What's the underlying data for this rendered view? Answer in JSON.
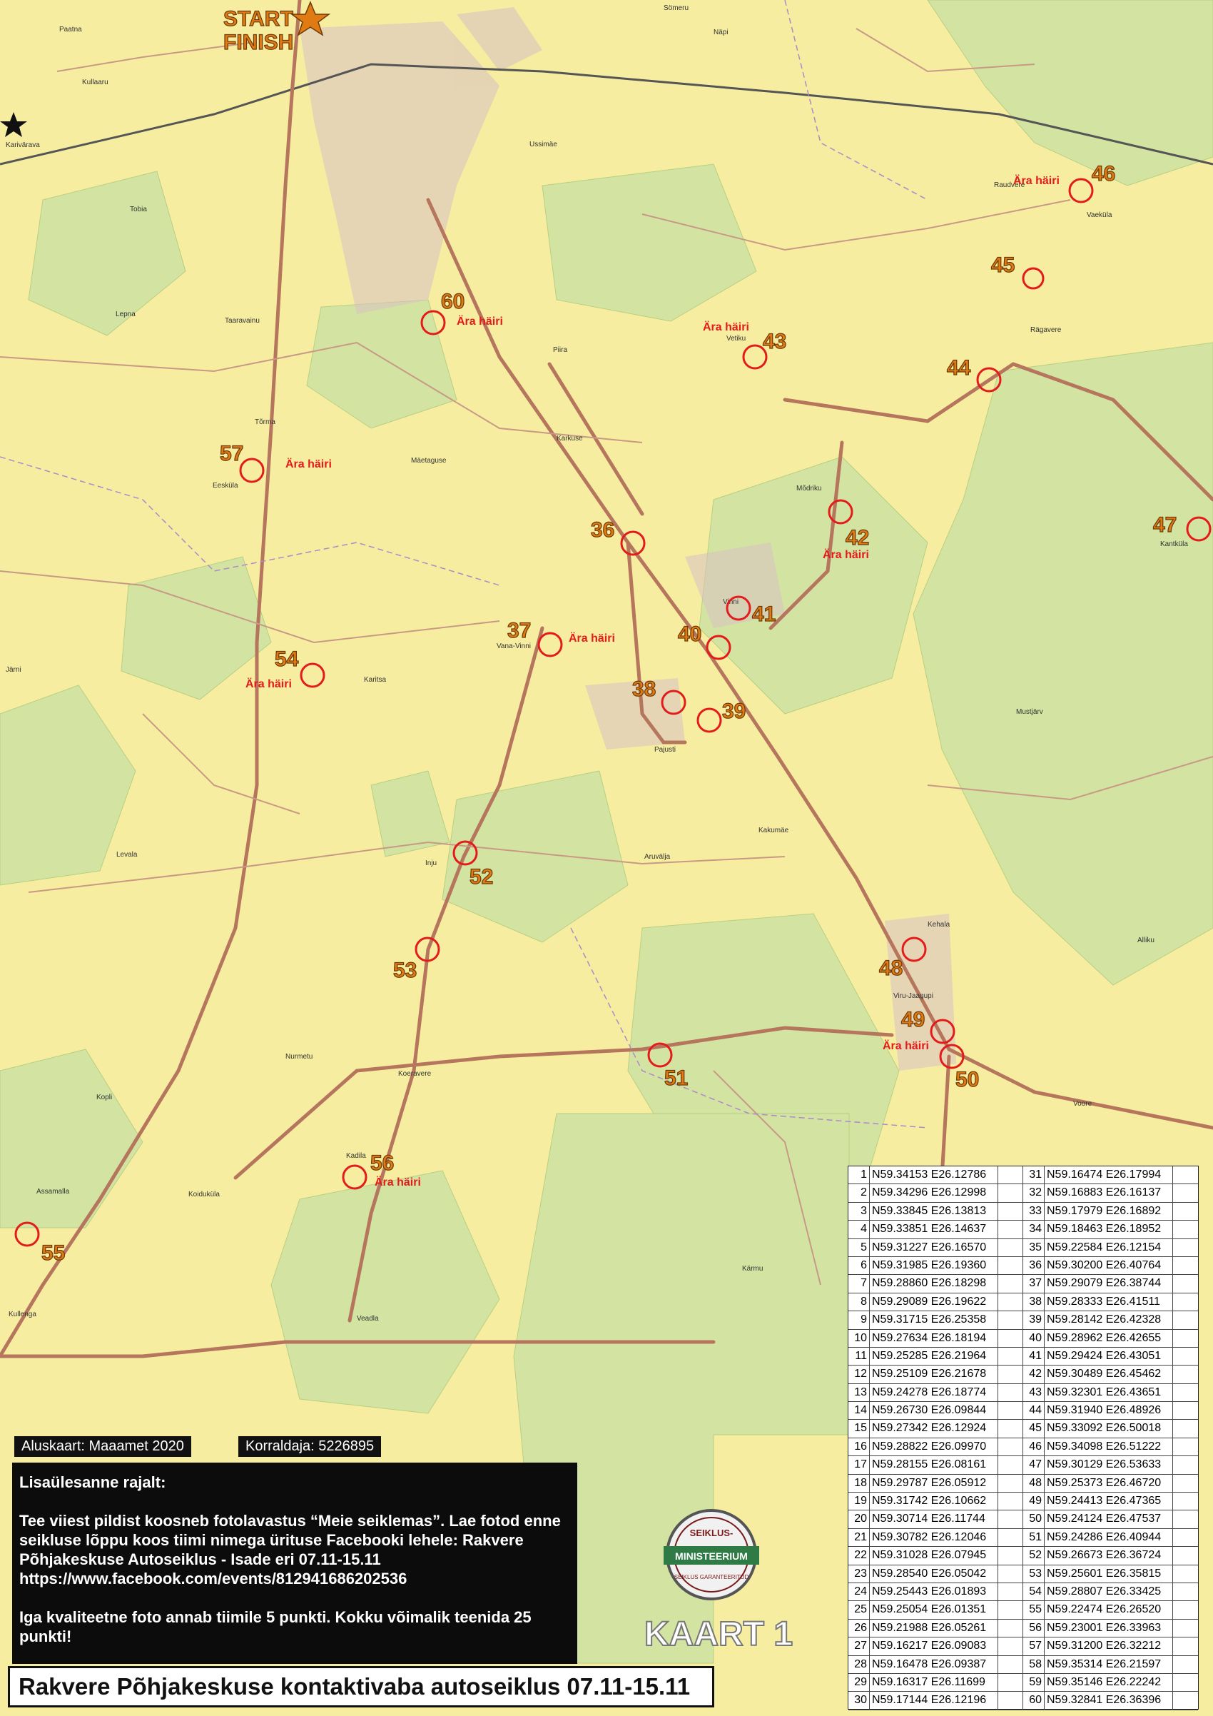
{
  "start_label": "START",
  "finish_label": "FINISH",
  "map_label": "KAART 1",
  "base_map_credit": "Aluskaart: Maaamet 2020",
  "editor_credit": "Korraldaja: 5226895",
  "info": {
    "heading": "Lisaülesanne rajalt:",
    "paragraph1": "Tee viiest pildist koosneb fotolavastus “Meie seiklemas”. Lae fotod enne seikluse lõppu koos tiimi nimega ürituse Facebooki lehele: Rakvere Põhjakeskuse Autoseiklus - Isade eri 07.11-15.11",
    "url": "https://www.facebook.com/events/812941686202536",
    "paragraph2": "Iga kvaliteetne foto annab tiimile 5 punkti. Kokku võimalik teenida 25 punkti!"
  },
  "title": "Rakvere Põhjakeskuse kontaktivaba autoseiklus 07.11-15.11",
  "seal": {
    "top_text": "SEIKLUS-",
    "middle_text": "MINISTEERIUM",
    "bottom_text": "SEIKLUS GARANTEERITUD"
  },
  "colors": {
    "land": "#f6eda0",
    "forest": "#d2e3a2",
    "road": "#b5765d",
    "checkpoint": "#e31b1b",
    "number": "#e07a12"
  },
  "checkpoints": [
    {
      "n": "60",
      "note": "Ära häiri"
    },
    {
      "n": "43",
      "note": "Ära häiri"
    },
    {
      "n": "46",
      "note": "Ära häiri"
    },
    {
      "n": "45",
      "note": ""
    },
    {
      "n": "44",
      "note": ""
    },
    {
      "n": "57",
      "note": "Ära häiri"
    },
    {
      "n": "36",
      "note": ""
    },
    {
      "n": "42",
      "note": "Ära häiri"
    },
    {
      "n": "47",
      "note": ""
    },
    {
      "n": "41",
      "note": ""
    },
    {
      "n": "40",
      "note": ""
    },
    {
      "n": "37",
      "note": "Ära häiri"
    },
    {
      "n": "54",
      "note": "Ära häiri"
    },
    {
      "n": "38",
      "note": ""
    },
    {
      "n": "39",
      "note": ""
    },
    {
      "n": "52",
      "note": ""
    },
    {
      "n": "53",
      "note": ""
    },
    {
      "n": "48",
      "note": ""
    },
    {
      "n": "49",
      "note": "Ära häiri"
    },
    {
      "n": "50",
      "note": ""
    },
    {
      "n": "51",
      "note": ""
    },
    {
      "n": "56",
      "note": "Ära häiri"
    },
    {
      "n": "55",
      "note": ""
    }
  ],
  "places": [
    "Sömeru",
    "Näpi",
    "Paatna",
    "Kullaaru",
    "Karivärava",
    "Tobia",
    "Ussimäe",
    "Lepna",
    "Taaravainu",
    "Tõrma",
    "Eesküla",
    "Piira",
    "Karkuse",
    "Mäetaguse",
    "Rägavere",
    "Vetiku",
    "Vaeküla",
    "Raudvere",
    "Mõdriku",
    "Kantküla",
    "Vana-Vinni",
    "Vinni",
    "Pajusti",
    "Järni",
    "Karitsa",
    "Levala",
    "Inju",
    "Kakumäe",
    "Aruvälja",
    "Kehala",
    "Viru-Jaagupi",
    "Nurmetu",
    "Koeravere",
    "Kopli",
    "Assamalla",
    "Kadila",
    "Koiduküla",
    "Voore",
    "Kullenga",
    "Veadla",
    "Kärmu",
    "Alliku",
    "Mustjärv"
  ],
  "coordinates": [
    {
      "n": "1",
      "v": "N59.34153 E26.12786"
    },
    {
      "n": "2",
      "v": "N59.34296 E26.12998"
    },
    {
      "n": "3",
      "v": "N59.33845 E26.13813"
    },
    {
      "n": "4",
      "v": "N59.33851 E26.14637"
    },
    {
      "n": "5",
      "v": "N59.31227 E26.16570"
    },
    {
      "n": "6",
      "v": "N59.31985 E26.19360"
    },
    {
      "n": "7",
      "v": "N59.28860 E26.18298"
    },
    {
      "n": "8",
      "v": "N59.29089 E26.19622"
    },
    {
      "n": "9",
      "v": "N59.31715 E26.25358"
    },
    {
      "n": "10",
      "v": "N59.27634 E26.18194"
    },
    {
      "n": "11",
      "v": "N59.25285 E26.21964"
    },
    {
      "n": "12",
      "v": "N59.25109 E26.21678"
    },
    {
      "n": "13",
      "v": "N59.24278 E26.18774"
    },
    {
      "n": "14",
      "v": "N59.26730 E26.09844"
    },
    {
      "n": "15",
      "v": "N59.27342 E26.12924"
    },
    {
      "n": "16",
      "v": "N59.28822 E26.09970"
    },
    {
      "n": "17",
      "v": "N59.28155 E26.08161"
    },
    {
      "n": "18",
      "v": "N59.29787 E26.05912"
    },
    {
      "n": "19",
      "v": "N59.31742 E26.10662"
    },
    {
      "n": "20",
      "v": "N59.30714 E26.11744"
    },
    {
      "n": "21",
      "v": "N59.30782 E26.12046"
    },
    {
      "n": "22",
      "v": "N59.31028 E26.07945"
    },
    {
      "n": "23",
      "v": "N59.28540 E26.05042"
    },
    {
      "n": "24",
      "v": "N59.25443 E26.01893"
    },
    {
      "n": "25",
      "v": "N59.25054 E26.01351"
    },
    {
      "n": "26",
      "v": "N59.21988 E26.05261"
    },
    {
      "n": "27",
      "v": "N59.16217 E26.09083"
    },
    {
      "n": "28",
      "v": "N59.16478 E26.09387"
    },
    {
      "n": "29",
      "v": "N59.16317 E26.11699"
    },
    {
      "n": "30",
      "v": "N59.17144 E26.12196"
    },
    {
      "n": "31",
      "v": "N59.16474 E26.17994"
    },
    {
      "n": "32",
      "v": "N59.16883 E26.16137"
    },
    {
      "n": "33",
      "v": "N59.17979 E26.16892"
    },
    {
      "n": "34",
      "v": "N59.18463 E26.18952"
    },
    {
      "n": "35",
      "v": "N59.22584 E26.12154"
    },
    {
      "n": "36",
      "v": "N59.30200 E26.40764"
    },
    {
      "n": "37",
      "v": "N59.29079 E26.38744"
    },
    {
      "n": "38",
      "v": "N59.28333 E26.41511"
    },
    {
      "n": "39",
      "v": "N59.28142 E26.42328"
    },
    {
      "n": "40",
      "v": "N59.28962 E26.42655"
    },
    {
      "n": "41",
      "v": "N59.29424 E26.43051"
    },
    {
      "n": "42",
      "v": "N59.30489 E26.45462"
    },
    {
      "n": "43",
      "v": "N59.32301 E26.43651"
    },
    {
      "n": "44",
      "v": "N59.31940 E26.48926"
    },
    {
      "n": "45",
      "v": "N59.33092 E26.50018"
    },
    {
      "n": "46",
      "v": "N59.34098 E26.51222"
    },
    {
      "n": "47",
      "v": "N59.30129 E26.53633"
    },
    {
      "n": "48",
      "v": "N59.25373 E26.46720"
    },
    {
      "n": "49",
      "v": "N59.24413 E26.47365"
    },
    {
      "n": "50",
      "v": "N59.24124 E26.47537"
    },
    {
      "n": "51",
      "v": "N59.24286 E26.40944"
    },
    {
      "n": "52",
      "v": "N59.26673 E26.36724"
    },
    {
      "n": "53",
      "v": "N59.25601 E26.35815"
    },
    {
      "n": "54",
      "v": "N59.28807 E26.33425"
    },
    {
      "n": "55",
      "v": "N59.22474 E26.26520"
    },
    {
      "n": "56",
      "v": "N59.23001 E26.33963"
    },
    {
      "n": "57",
      "v": "N59.31200 E26.32212"
    },
    {
      "n": "58",
      "v": "N59.35314 E26.21597"
    },
    {
      "n": "59",
      "v": "N59.35146 E26.22242"
    },
    {
      "n": "60",
      "v": "N59.32841 E26.36396"
    }
  ]
}
